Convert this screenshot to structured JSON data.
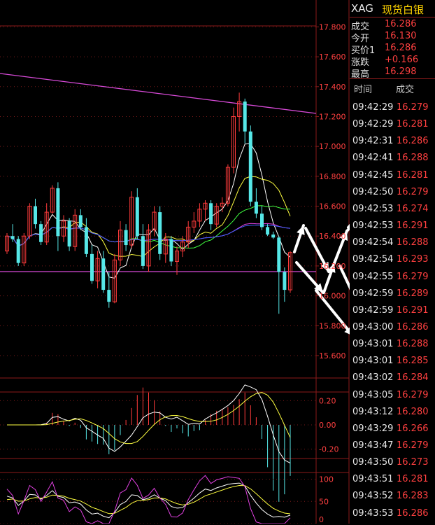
{
  "header": {
    "code": "XAG",
    "name": "现货白银"
  },
  "quote": [
    {
      "label": "成交",
      "value": "16.286"
    },
    {
      "label": "今开",
      "value": "16.130"
    },
    {
      "label": "买价1",
      "value": "16.286"
    },
    {
      "label": "涨跌",
      "value": "+0.166"
    },
    {
      "label": "最高",
      "value": "16.298"
    }
  ],
  "ticks_header": {
    "time": "时间",
    "price": "成交"
  },
  "ticks": [
    {
      "time": "09:42:29",
      "price": "16.279"
    },
    {
      "time": "09:42:29",
      "price": "16.281"
    },
    {
      "time": "09:42:31",
      "price": "16.286"
    },
    {
      "time": "09:42:41",
      "price": "16.288"
    },
    {
      "time": "09:42:45",
      "price": "16.281"
    },
    {
      "time": "09:42:50",
      "price": "16.279"
    },
    {
      "time": "09:42:53",
      "price": "16.274"
    },
    {
      "time": "09:42:53",
      "price": "16.291"
    },
    {
      "time": "09:42:54",
      "price": "16.288"
    },
    {
      "time": "09:42:54",
      "price": "16.293"
    },
    {
      "time": "09:42:55",
      "price": "16.279"
    },
    {
      "time": "09:42:59",
      "price": "16.289"
    },
    {
      "time": "09:42:59",
      "price": "16.291"
    },
    {
      "time": "09:43:00",
      "price": "16.286"
    },
    {
      "time": "09:43:01",
      "price": "16.288"
    },
    {
      "time": "09:43:01",
      "price": "16.285"
    },
    {
      "time": "09:43:02",
      "price": "16.284"
    },
    {
      "time": "09:43:05",
      "price": "16.279"
    },
    {
      "time": "09:43:12",
      "price": "16.280"
    },
    {
      "time": "09:43:29",
      "price": "16.266"
    },
    {
      "time": "09:43:47",
      "price": "16.279"
    },
    {
      "time": "09:43:50",
      "price": "16.273"
    },
    {
      "time": "09:43:51",
      "price": "16.281"
    },
    {
      "time": "09:43:52",
      "price": "16.283"
    },
    {
      "time": "09:43:53",
      "price": "16.286"
    }
  ],
  "chart_data": [
    {
      "type": "candlestick",
      "ylim": [
        15.45,
        17.98
      ],
      "yticks": [
        "17.800",
        "17.600",
        "17.400",
        "17.200",
        "17.000",
        "16.800",
        "16.600",
        "16.400",
        "16.200",
        "16.000",
        "15.800",
        "15.600"
      ],
      "candles": [
        [
          16.3,
          16.42,
          16.28,
          16.4
        ],
        [
          16.4,
          16.48,
          16.36,
          16.38
        ],
        [
          16.38,
          16.4,
          16.2,
          16.22
        ],
        [
          16.22,
          16.42,
          16.2,
          16.4
        ],
        [
          16.4,
          16.62,
          16.38,
          16.6
        ],
        [
          16.6,
          16.65,
          16.45,
          16.48
        ],
        [
          16.48,
          16.5,
          16.34,
          16.36
        ],
        [
          16.36,
          16.62,
          16.34,
          16.56
        ],
        [
          16.56,
          16.74,
          16.55,
          16.72
        ],
        [
          16.72,
          16.76,
          16.3,
          16.4
        ],
        [
          16.4,
          16.54,
          16.36,
          16.5
        ],
        [
          16.5,
          16.52,
          16.3,
          16.33
        ],
        [
          16.33,
          16.58,
          16.3,
          16.54
        ],
        [
          16.54,
          16.58,
          16.44,
          16.46
        ],
        [
          16.46,
          16.52,
          16.26,
          16.28
        ],
        [
          16.28,
          16.34,
          16.08,
          16.1
        ],
        [
          16.1,
          16.3,
          16.05,
          16.25
        ],
        [
          16.25,
          16.3,
          16.02,
          16.04
        ],
        [
          16.04,
          16.16,
          15.92,
          15.96
        ],
        [
          15.96,
          16.28,
          15.95,
          16.24
        ],
        [
          16.24,
          16.5,
          16.2,
          16.44
        ],
        [
          16.44,
          16.48,
          16.3,
          16.34
        ],
        [
          16.34,
          16.7,
          16.32,
          16.66
        ],
        [
          16.66,
          16.72,
          16.38,
          16.4
        ],
        [
          16.4,
          16.48,
          16.18,
          16.2
        ],
        [
          16.2,
          16.48,
          16.16,
          16.44
        ],
        [
          16.44,
          16.6,
          16.4,
          16.56
        ],
        [
          16.56,
          16.6,
          16.24,
          16.28
        ],
        [
          16.28,
          16.42,
          16.22,
          16.38
        ],
        [
          16.38,
          16.4,
          16.2,
          16.23
        ],
        [
          16.23,
          16.33,
          16.14,
          16.3
        ],
        [
          16.3,
          16.4,
          16.26,
          16.36
        ],
        [
          16.36,
          16.5,
          16.32,
          16.46
        ],
        [
          16.46,
          16.56,
          16.42,
          16.5
        ],
        [
          16.5,
          16.62,
          16.46,
          16.58
        ],
        [
          16.58,
          16.64,
          16.5,
          16.62
        ],
        [
          16.62,
          16.64,
          16.44,
          16.48
        ],
        [
          16.48,
          16.62,
          16.46,
          16.6
        ],
        [
          16.6,
          16.66,
          16.56,
          16.62
        ],
        [
          16.62,
          16.88,
          16.6,
          16.86
        ],
        [
          16.86,
          17.26,
          16.82,
          17.2
        ],
        [
          17.2,
          17.36,
          17.1,
          17.3
        ],
        [
          17.3,
          17.32,
          17.02,
          17.1
        ],
        [
          17.1,
          17.14,
          16.6,
          16.63
        ],
        [
          16.63,
          16.72,
          16.52,
          16.55
        ],
        [
          16.55,
          16.6,
          16.44,
          16.46
        ],
        [
          16.46,
          16.48,
          16.4,
          16.41
        ],
        [
          16.41,
          16.43,
          16.38,
          16.39
        ],
        [
          16.39,
          16.4,
          15.88,
          16.16
        ],
        [
          16.16,
          16.19,
          15.96,
          16.04
        ],
        [
          16.04,
          16.3,
          16.02,
          16.29
        ]
      ]
    },
    {
      "type": "bar",
      "yticks": [
        "0.20",
        "0.00",
        "-0.20"
      ],
      "ylim": [
        -0.26,
        0.26
      ]
    },
    {
      "type": "line",
      "yticks": [
        "100",
        "50",
        "0"
      ],
      "ylim": [
        0,
        112
      ]
    }
  ]
}
